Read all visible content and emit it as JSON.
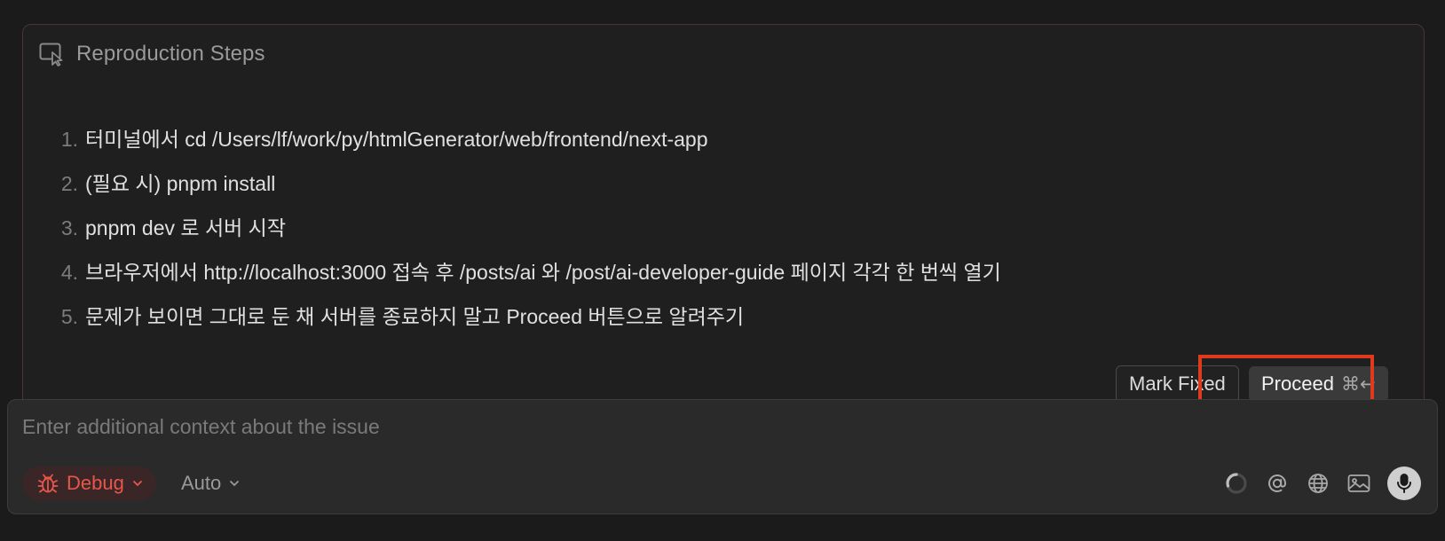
{
  "panel": {
    "title": "Reproduction Steps",
    "icon": "cursor-window-icon",
    "border_color": "#4a3434"
  },
  "steps": [
    {
      "num": "1.",
      "text": "터미널에서 cd /Users/lf/work/py/htmlGenerator/web/frontend/next-app"
    },
    {
      "num": "2.",
      "text": "(필요 시) pnpm install"
    },
    {
      "num": "3.",
      "text": "pnpm dev 로 서버 시작"
    },
    {
      "num": "4.",
      "text": "브라우저에서 http://localhost:3000 접속 후 /posts/ai 와 /post/ai-developer-guide 페이지 각각 한 번씩 열기"
    },
    {
      "num": "5.",
      "text": "문제가 보이면 그대로 둔 채 서버를 종료하지 말고 Proceed 버튼으로 알려주기"
    }
  ],
  "actions": {
    "mark_fixed_label": "Mark Fixed",
    "proceed_label": "Proceed",
    "proceed_shortcut": "⌘↩",
    "highlight_color": "#e03a1e"
  },
  "composer": {
    "placeholder": "Enter additional context about the issue",
    "value": "",
    "mode_label": "Debug",
    "mode_icon": "bug-icon",
    "mode_color": "#e8564b",
    "model_label": "Auto",
    "tools": [
      "loading-spinner-icon",
      "at-icon",
      "globe-icon",
      "image-icon",
      "microphone-icon"
    ]
  }
}
